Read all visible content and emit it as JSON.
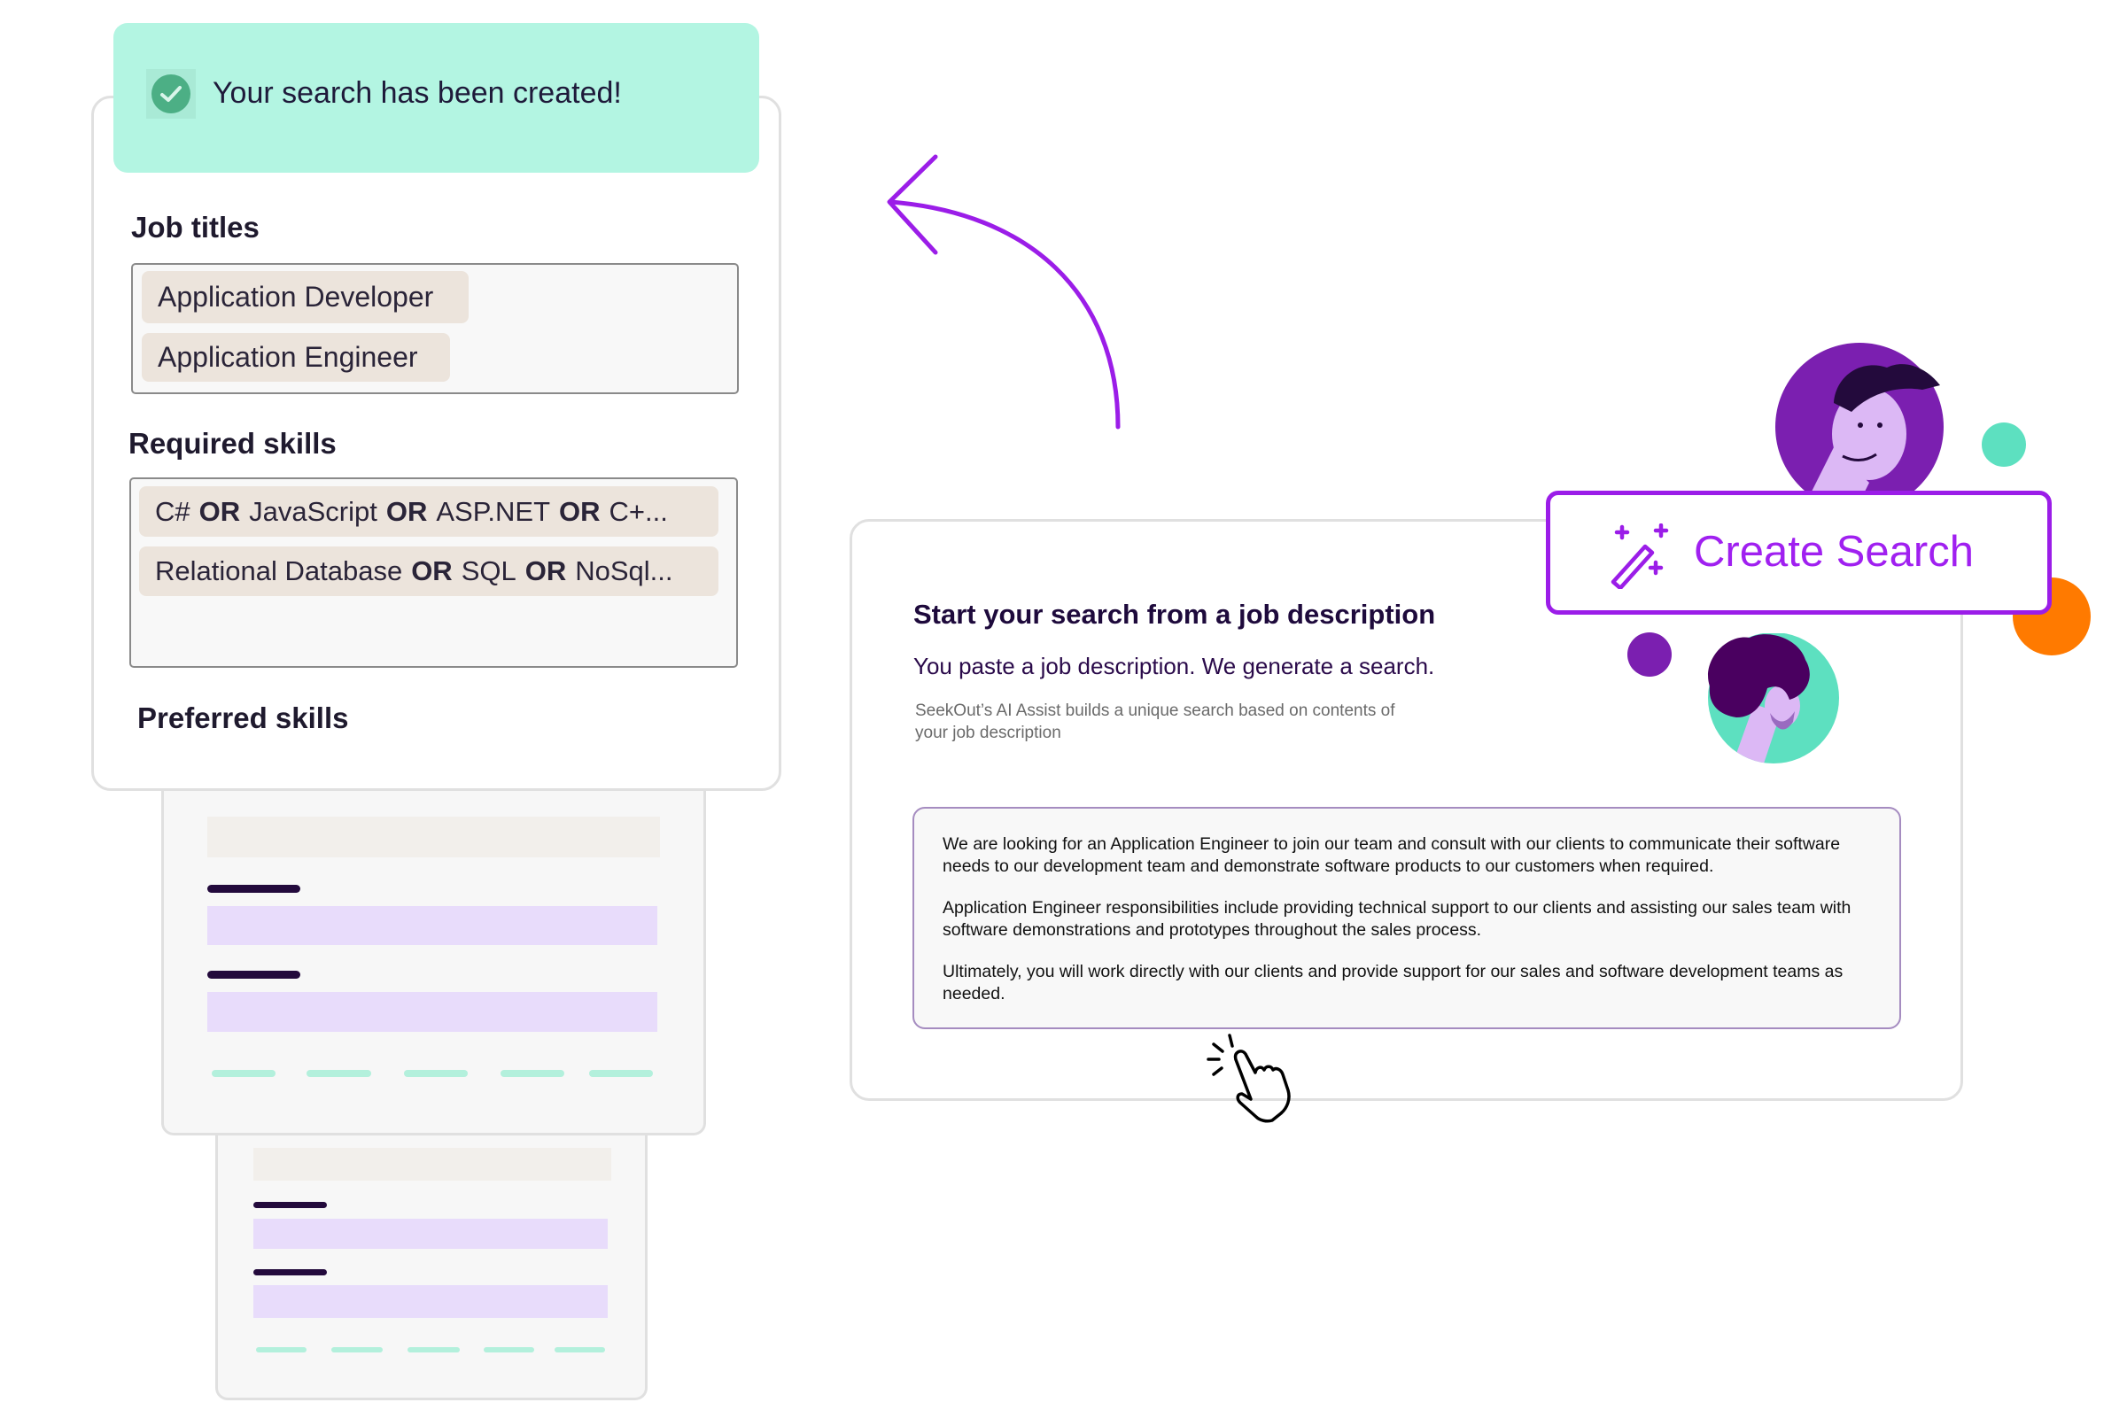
{
  "toast": {
    "message": "Your search has been created!",
    "icon": "check-circle-icon"
  },
  "search_form": {
    "job_titles_label": "Job titles",
    "job_titles": [
      "Application Developer",
      "Application Engineer"
    ],
    "required_skills_label": "Required skills",
    "required_skills": [
      {
        "parts": [
          "C#",
          "OR",
          "JavaScript",
          "OR",
          "ASP.NET",
          "OR",
          "C+..."
        ]
      },
      {
        "parts": [
          "Relational Database",
          "OR",
          "SQL",
          "OR",
          "NoSql..."
        ]
      }
    ],
    "preferred_skills_label": "Preferred skills"
  },
  "job_description_card": {
    "title": "Start your search from a job description",
    "subtitle": "You paste a job description. We generate a search.",
    "helper_line1": "SeekOut’s AI Assist builds a unique search based on contents of",
    "helper_line2": "your job description",
    "paragraphs": [
      "We are looking for an Application Engineer to join our team and consult with our clients to communicate their software needs to our development team and demonstrate software products to our customers when required.",
      "Application Engineer responsibilities include providing technical support to our clients and assisting our sales team with software demonstrations and prototypes throughout the sales process.",
      "Ultimately, you will work directly with our clients and provide support for our sales and software development teams as needed."
    ]
  },
  "create_search_button": {
    "label": "Create Search",
    "icon": "magic-wand-icon"
  },
  "colors": {
    "accent_purple": "#9b1de8",
    "toast_bg": "#b3f5e2",
    "success_green": "#4caf85",
    "chip_bg": "#ece4dc",
    "teal": "#5de0c0",
    "orange": "#ff7a00",
    "avatar_purple": "#7b1fb0",
    "lavender": "#e8dcfb"
  }
}
